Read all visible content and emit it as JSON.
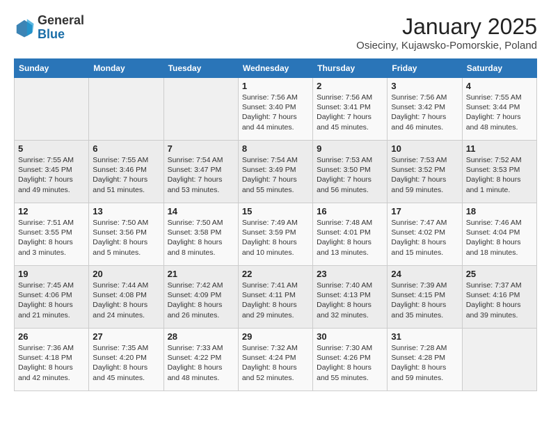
{
  "header": {
    "logo_general": "General",
    "logo_blue": "Blue",
    "month": "January 2025",
    "location": "Osieciny, Kujawsko-Pomorskie, Poland"
  },
  "weekdays": [
    "Sunday",
    "Monday",
    "Tuesday",
    "Wednesday",
    "Thursday",
    "Friday",
    "Saturday"
  ],
  "weeks": [
    [
      {
        "day": "",
        "info": ""
      },
      {
        "day": "",
        "info": ""
      },
      {
        "day": "",
        "info": ""
      },
      {
        "day": "1",
        "info": "Sunrise: 7:56 AM\nSunset: 3:40 PM\nDaylight: 7 hours\nand 44 minutes."
      },
      {
        "day": "2",
        "info": "Sunrise: 7:56 AM\nSunset: 3:41 PM\nDaylight: 7 hours\nand 45 minutes."
      },
      {
        "day": "3",
        "info": "Sunrise: 7:56 AM\nSunset: 3:42 PM\nDaylight: 7 hours\nand 46 minutes."
      },
      {
        "day": "4",
        "info": "Sunrise: 7:55 AM\nSunset: 3:44 PM\nDaylight: 7 hours\nand 48 minutes."
      }
    ],
    [
      {
        "day": "5",
        "info": "Sunrise: 7:55 AM\nSunset: 3:45 PM\nDaylight: 7 hours\nand 49 minutes."
      },
      {
        "day": "6",
        "info": "Sunrise: 7:55 AM\nSunset: 3:46 PM\nDaylight: 7 hours\nand 51 minutes."
      },
      {
        "day": "7",
        "info": "Sunrise: 7:54 AM\nSunset: 3:47 PM\nDaylight: 7 hours\nand 53 minutes."
      },
      {
        "day": "8",
        "info": "Sunrise: 7:54 AM\nSunset: 3:49 PM\nDaylight: 7 hours\nand 55 minutes."
      },
      {
        "day": "9",
        "info": "Sunrise: 7:53 AM\nSunset: 3:50 PM\nDaylight: 7 hours\nand 56 minutes."
      },
      {
        "day": "10",
        "info": "Sunrise: 7:53 AM\nSunset: 3:52 PM\nDaylight: 7 hours\nand 59 minutes."
      },
      {
        "day": "11",
        "info": "Sunrise: 7:52 AM\nSunset: 3:53 PM\nDaylight: 8 hours\nand 1 minute."
      }
    ],
    [
      {
        "day": "12",
        "info": "Sunrise: 7:51 AM\nSunset: 3:55 PM\nDaylight: 8 hours\nand 3 minutes."
      },
      {
        "day": "13",
        "info": "Sunrise: 7:50 AM\nSunset: 3:56 PM\nDaylight: 8 hours\nand 5 minutes."
      },
      {
        "day": "14",
        "info": "Sunrise: 7:50 AM\nSunset: 3:58 PM\nDaylight: 8 hours\nand 8 minutes."
      },
      {
        "day": "15",
        "info": "Sunrise: 7:49 AM\nSunset: 3:59 PM\nDaylight: 8 hours\nand 10 minutes."
      },
      {
        "day": "16",
        "info": "Sunrise: 7:48 AM\nSunset: 4:01 PM\nDaylight: 8 hours\nand 13 minutes."
      },
      {
        "day": "17",
        "info": "Sunrise: 7:47 AM\nSunset: 4:02 PM\nDaylight: 8 hours\nand 15 minutes."
      },
      {
        "day": "18",
        "info": "Sunrise: 7:46 AM\nSunset: 4:04 PM\nDaylight: 8 hours\nand 18 minutes."
      }
    ],
    [
      {
        "day": "19",
        "info": "Sunrise: 7:45 AM\nSunset: 4:06 PM\nDaylight: 8 hours\nand 21 minutes."
      },
      {
        "day": "20",
        "info": "Sunrise: 7:44 AM\nSunset: 4:08 PM\nDaylight: 8 hours\nand 24 minutes."
      },
      {
        "day": "21",
        "info": "Sunrise: 7:42 AM\nSunset: 4:09 PM\nDaylight: 8 hours\nand 26 minutes."
      },
      {
        "day": "22",
        "info": "Sunrise: 7:41 AM\nSunset: 4:11 PM\nDaylight: 8 hours\nand 29 minutes."
      },
      {
        "day": "23",
        "info": "Sunrise: 7:40 AM\nSunset: 4:13 PM\nDaylight: 8 hours\nand 32 minutes."
      },
      {
        "day": "24",
        "info": "Sunrise: 7:39 AM\nSunset: 4:15 PM\nDaylight: 8 hours\nand 35 minutes."
      },
      {
        "day": "25",
        "info": "Sunrise: 7:37 AM\nSunset: 4:16 PM\nDaylight: 8 hours\nand 39 minutes."
      }
    ],
    [
      {
        "day": "26",
        "info": "Sunrise: 7:36 AM\nSunset: 4:18 PM\nDaylight: 8 hours\nand 42 minutes."
      },
      {
        "day": "27",
        "info": "Sunrise: 7:35 AM\nSunset: 4:20 PM\nDaylight: 8 hours\nand 45 minutes."
      },
      {
        "day": "28",
        "info": "Sunrise: 7:33 AM\nSunset: 4:22 PM\nDaylight: 8 hours\nand 48 minutes."
      },
      {
        "day": "29",
        "info": "Sunrise: 7:32 AM\nSunset: 4:24 PM\nDaylight: 8 hours\nand 52 minutes."
      },
      {
        "day": "30",
        "info": "Sunrise: 7:30 AM\nSunset: 4:26 PM\nDaylight: 8 hours\nand 55 minutes."
      },
      {
        "day": "31",
        "info": "Sunrise: 7:28 AM\nSunset: 4:28 PM\nDaylight: 8 hours\nand 59 minutes."
      },
      {
        "day": "",
        "info": ""
      }
    ]
  ]
}
